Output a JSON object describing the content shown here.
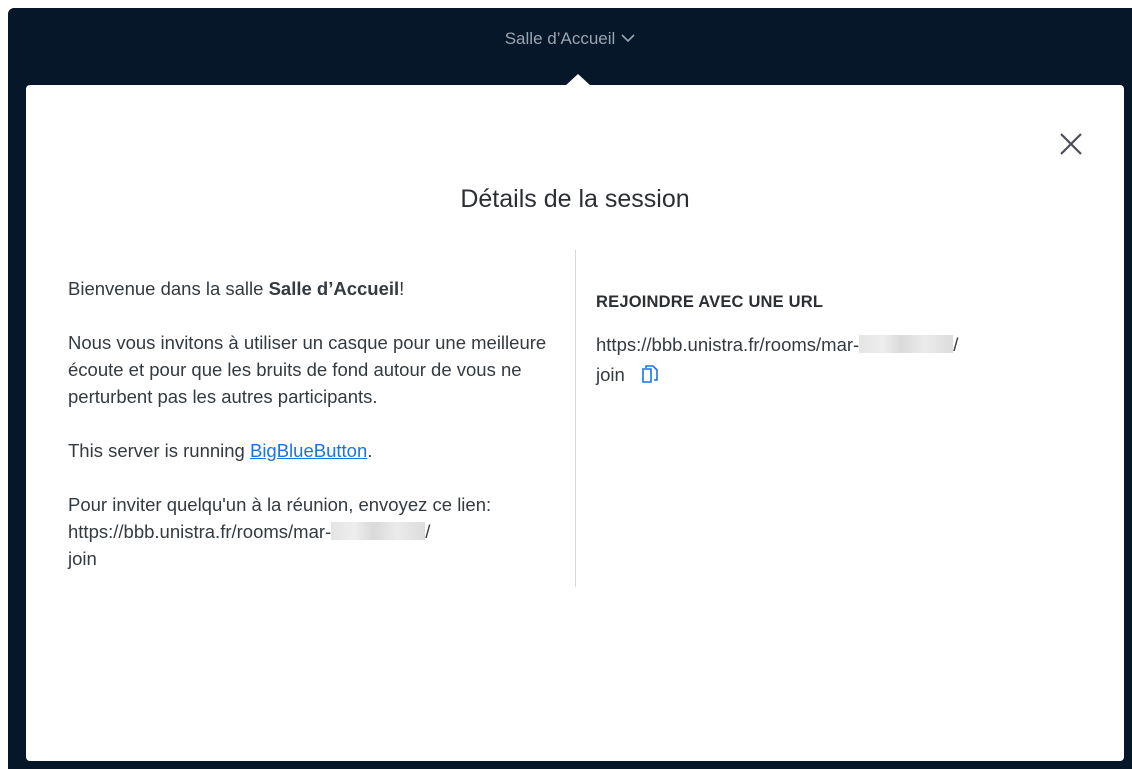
{
  "header": {
    "room_title": "Salle d’Accueil",
    "chevron_icon": "chevron-down-icon"
  },
  "modal": {
    "title": "Détails de la session",
    "close_icon": "close-icon",
    "welcome": {
      "prefix": "Bienvenue dans la salle ",
      "room_name": "Salle d’Accueil",
      "suffix": "!"
    },
    "headset_advice": "Nous vous invitons à utiliser un casque pour une meilleure écoute et pour que les bruits de fond autour de vous ne perturbent pas les autres participants.",
    "server_info": {
      "prefix": "This server is running ",
      "link_label": "BigBlueButton",
      "suffix": "."
    },
    "invite": {
      "intro": "Pour inviter quelqu'un à la réunion, envoyez ce lien:",
      "url_start": "https://bbb.unistra.fr/rooms/mar-",
      "url_end": "/",
      "url_last_line": "join"
    },
    "join_url": {
      "heading": "REJOINDRE AVEC UNE URL",
      "url_start": "https://bbb.unistra.fr/rooms/mar-",
      "url_end": "/",
      "url_last_line": "join",
      "copy_icon": "copy-icon"
    }
  },
  "colors": {
    "dark_background": "#06172a",
    "link": "#1a73e8",
    "text": "#333a40"
  }
}
